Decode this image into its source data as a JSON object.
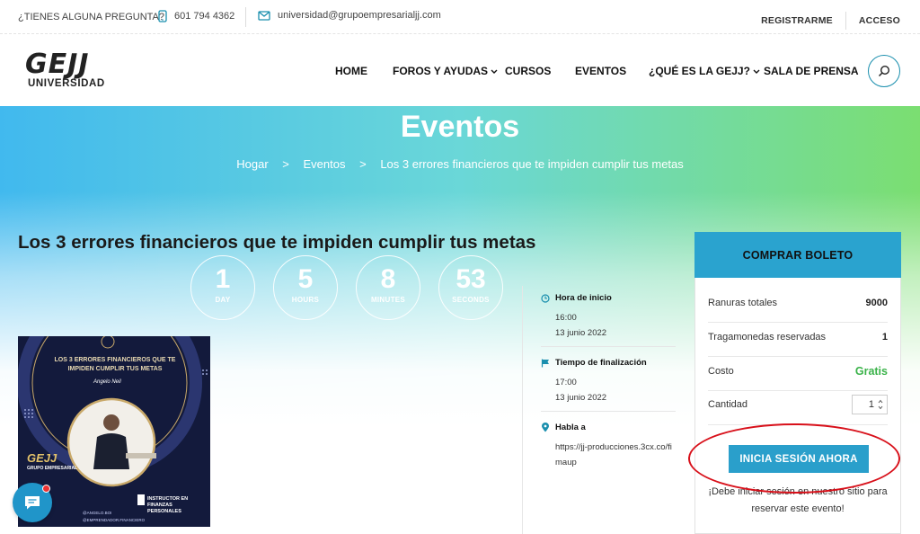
{
  "topbar": {
    "question": "¿TIENES ALGUNA PREGUNTA?",
    "phone": "601 794 4362",
    "email": "universidad@grupoempresarialjj.com",
    "register": "REGISTRARME",
    "login": "ACCESO"
  },
  "logo": {
    "line1": "GEJJ",
    "line2": "UNIVERSIDAD"
  },
  "nav": {
    "home": "HOME",
    "forums": "FOROS Y AYUDAS",
    "courses": "CURSOS",
    "events": "EVENTOS",
    "about": "¿QUÉ ES LA GEJJ?",
    "press": "SALA DE PRENSA"
  },
  "hero": {
    "title": "Eventos",
    "breadcrumb": [
      "Hogar",
      ">",
      "Eventos",
      ">",
      "Los 3 errores financieros que te impiden cumplir tus metas"
    ]
  },
  "event": {
    "title": "Los 3 errores financieros que te impiden cumplir tus metas",
    "countdown": [
      {
        "value": "1",
        "unit": "DAY"
      },
      {
        "value": "5",
        "unit": "HOURS"
      },
      {
        "value": "8",
        "unit": "MINUTES"
      },
      {
        "value": "53",
        "unit": "SECONDS"
      }
    ],
    "poster": {
      "headline": "LOS 3 ERRORES FINANCIEROS QUE TE IMPIDEN CUMPLIR TUS METAS",
      "signature": "Angelo Neil",
      "brand": "GEJJ",
      "brand_sub": "GRUPO EMPRESARIAL",
      "badge": "INSTRUCTOR EN FINANZAS PERSONALES",
      "handle1": "@ANGELO.BOI",
      "handle2": "@EMPRENDADOR.FINANCIERO"
    },
    "start_label": "Hora de inicio",
    "start_time": "16:00",
    "start_date": "13 junio 2022",
    "end_label": "Tiempo de finalización",
    "end_time": "17:00",
    "end_date": "13 junio 2022",
    "where_label": "Habla a",
    "where_value": "https://jj-producciones.3cx.co/fimaup"
  },
  "ticket": {
    "buy": "COMPRAR BOLETO",
    "slots_label": "Ranuras totales",
    "slots_value": "9000",
    "reserved_label": "Tragamonedas reservadas",
    "reserved_value": "1",
    "cost_label": "Costo",
    "cost_value": "Gratis",
    "qty_label": "Cantidad",
    "qty_value": "1",
    "login_button": "INICIA SESIÓN AHORA",
    "login_msg": "¡Debe iniciar sesión en nuestro sitio para reservar este evento!"
  },
  "colors": {
    "accent": "#2aa3cf",
    "free": "#3bb34a",
    "highlight_ring": "#d8101a"
  }
}
